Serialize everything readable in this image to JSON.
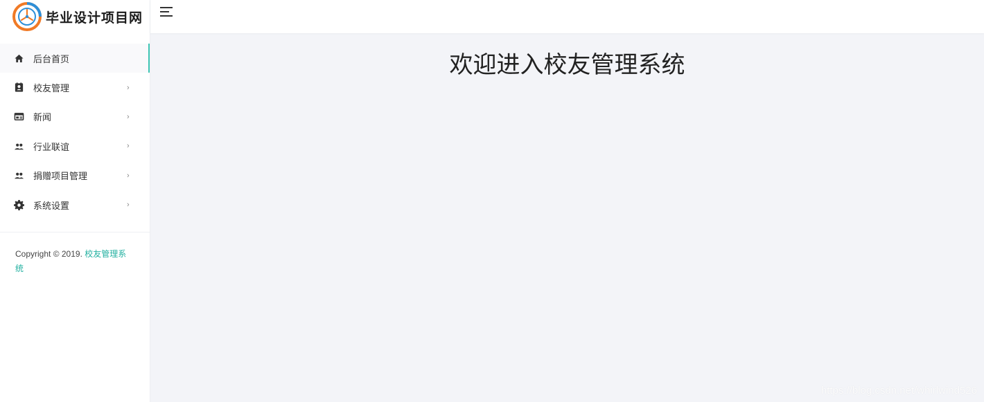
{
  "brand": {
    "logo_icon": "logo-icon",
    "title": "毕业设计项目网"
  },
  "sidebar": {
    "items": [
      {
        "label": "后台首页",
        "icon": "home-icon",
        "active": true,
        "has_submenu": false
      },
      {
        "label": "校友管理",
        "icon": "contact-card-icon",
        "active": false,
        "has_submenu": true
      },
      {
        "label": "新闻",
        "icon": "news-icon",
        "active": false,
        "has_submenu": true
      },
      {
        "label": "行业联谊",
        "icon": "group-icon",
        "active": false,
        "has_submenu": true
      },
      {
        "label": "捐赠项目管理",
        "icon": "group-icon",
        "active": false,
        "has_submenu": true
      },
      {
        "label": "系统设置",
        "icon": "gear-icon",
        "active": false,
        "has_submenu": true
      }
    ],
    "arrow_glyph": "›",
    "copyright_prefix": "Copyright © 2019. ",
    "copyright_link": "校友管理系统"
  },
  "header": {
    "toggle_icon": "hamburger-icon"
  },
  "main": {
    "welcome": "欢迎进入校友管理系统"
  },
  "watermark": "https://blog.csdn.net/whirlwind526",
  "colors": {
    "accent": "#3ec6b4",
    "link": "#22b0a0",
    "background": "#f3f4f8",
    "sidebar_bg": "#ffffff"
  }
}
